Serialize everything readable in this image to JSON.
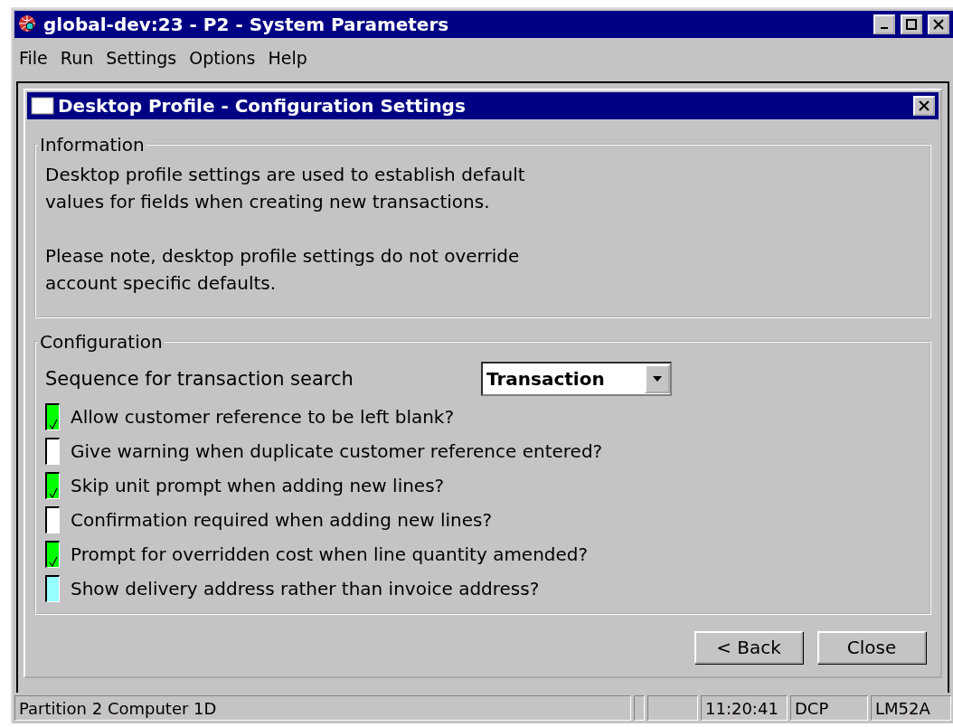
{
  "window": {
    "title": "global-dev:23 - P2 - System Parameters"
  },
  "menu": [
    "File",
    "Run",
    "Settings",
    "Options",
    "Help"
  ],
  "dialog": {
    "title": "Desktop Profile - Configuration Settings",
    "information": {
      "legend": "Information",
      "paragraphs": [
        "Desktop profile settings are used to establish default\nvalues for fields when creating new transactions.",
        "Please note, desktop profile settings do not override\naccount specific defaults."
      ]
    },
    "configuration": {
      "legend": "Configuration",
      "sequence": {
        "label": "Sequence for transaction search",
        "value": "Transaction"
      },
      "options": [
        {
          "label": "Allow customer reference to be left blank?",
          "checked": true,
          "focused": false
        },
        {
          "label": "Give warning when duplicate customer reference entered?",
          "checked": false,
          "focused": false
        },
        {
          "label": "Skip unit prompt when adding new lines?",
          "checked": true,
          "focused": false
        },
        {
          "label": "Confirmation required when adding new lines?",
          "checked": false,
          "focused": false
        },
        {
          "label": "Prompt for overridden cost when line quantity amended?",
          "checked": true,
          "focused": false
        },
        {
          "label": "Show delivery address rather than invoice address?",
          "checked": false,
          "focused": true
        }
      ]
    },
    "buttons": [
      "< Back",
      "Close"
    ]
  },
  "status_bar": {
    "message": "Partition 2 Computer 1D",
    "time": "11:20:41",
    "user": "DCP",
    "terminal": "LM52A"
  }
}
